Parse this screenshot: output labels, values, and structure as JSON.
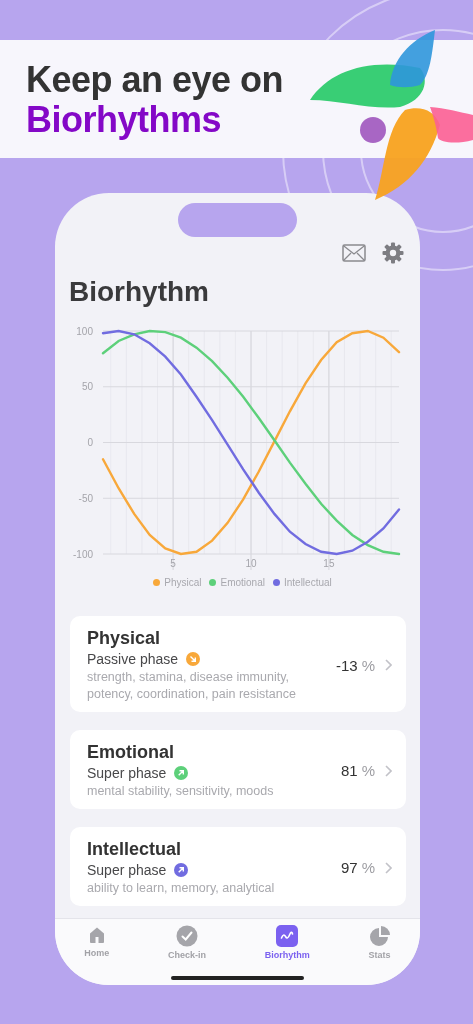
{
  "headline": {
    "text": "Keep an eye on",
    "highlight": "Biorhythms"
  },
  "screen": {
    "title": "Biorhythm",
    "chart_data": {
      "type": "line",
      "x": [
        0.5,
        1.5,
        2.5,
        3.5,
        4.5,
        5.5,
        6.5,
        7.5,
        8.5,
        9.5,
        10.5,
        11.5,
        12.5,
        13.5,
        14.5,
        15.5,
        16.5,
        17.5,
        18.5,
        19.5
      ],
      "xlim": [
        0.5,
        19.5
      ],
      "grid": true,
      "legend": true,
      "ylim": [
        -100,
        100
      ],
      "xticks": [
        5,
        10,
        15
      ],
      "yticks": [
        -100,
        -50,
        0,
        50,
        100
      ],
      "series": [
        {
          "name": "Physical",
          "color": "#f8a83a",
          "values": [
            -15,
            -41,
            -64,
            -83,
            -95,
            -100,
            -98,
            -88,
            -72,
            -51,
            -26,
            1,
            28,
            53,
            74,
            90,
            98,
            100,
            94,
            81
          ]
        },
        {
          "name": "Emotional",
          "color": "#5dd07a",
          "values": [
            80,
            91,
            97,
            100,
            99,
            94,
            85,
            73,
            58,
            41,
            22,
            2,
            -18,
            -37,
            -55,
            -70,
            -83,
            -92,
            -98,
            -100
          ]
        },
        {
          "name": "Intellectual",
          "color": "#716ce0",
          "values": [
            98,
            100,
            97,
            89,
            77,
            61,
            41,
            20,
            -2,
            -24,
            -45,
            -64,
            -80,
            -91,
            -98,
            -100,
            -97,
            -89,
            -77,
            -60
          ]
        }
      ]
    },
    "cards": [
      {
        "name": "Physical",
        "phase": "Passive phase",
        "rising": false,
        "color": "#f8a83a",
        "description": "strength, stamina, disease immunity, potency, coordination, pain resistance",
        "value": "-13",
        "unit": "%"
      },
      {
        "name": "Emotional",
        "phase": "Super phase",
        "rising": true,
        "color": "#5dd07a",
        "description": "mental stability, sensitivity, moods",
        "value": "81",
        "unit": "%"
      },
      {
        "name": "Intellectual",
        "phase": "Super phase",
        "rising": true,
        "color": "#716ce0",
        "description": "ability to learn, memory, analytical",
        "value": "97",
        "unit": "%"
      }
    ],
    "tabs": [
      {
        "label": "Home",
        "kind": "home",
        "selected": false
      },
      {
        "label": "Check-in",
        "kind": "check",
        "selected": false
      },
      {
        "label": "Biorhythm",
        "kind": "wave",
        "selected": true
      },
      {
        "label": "Stats",
        "kind": "pie",
        "selected": false
      }
    ]
  }
}
